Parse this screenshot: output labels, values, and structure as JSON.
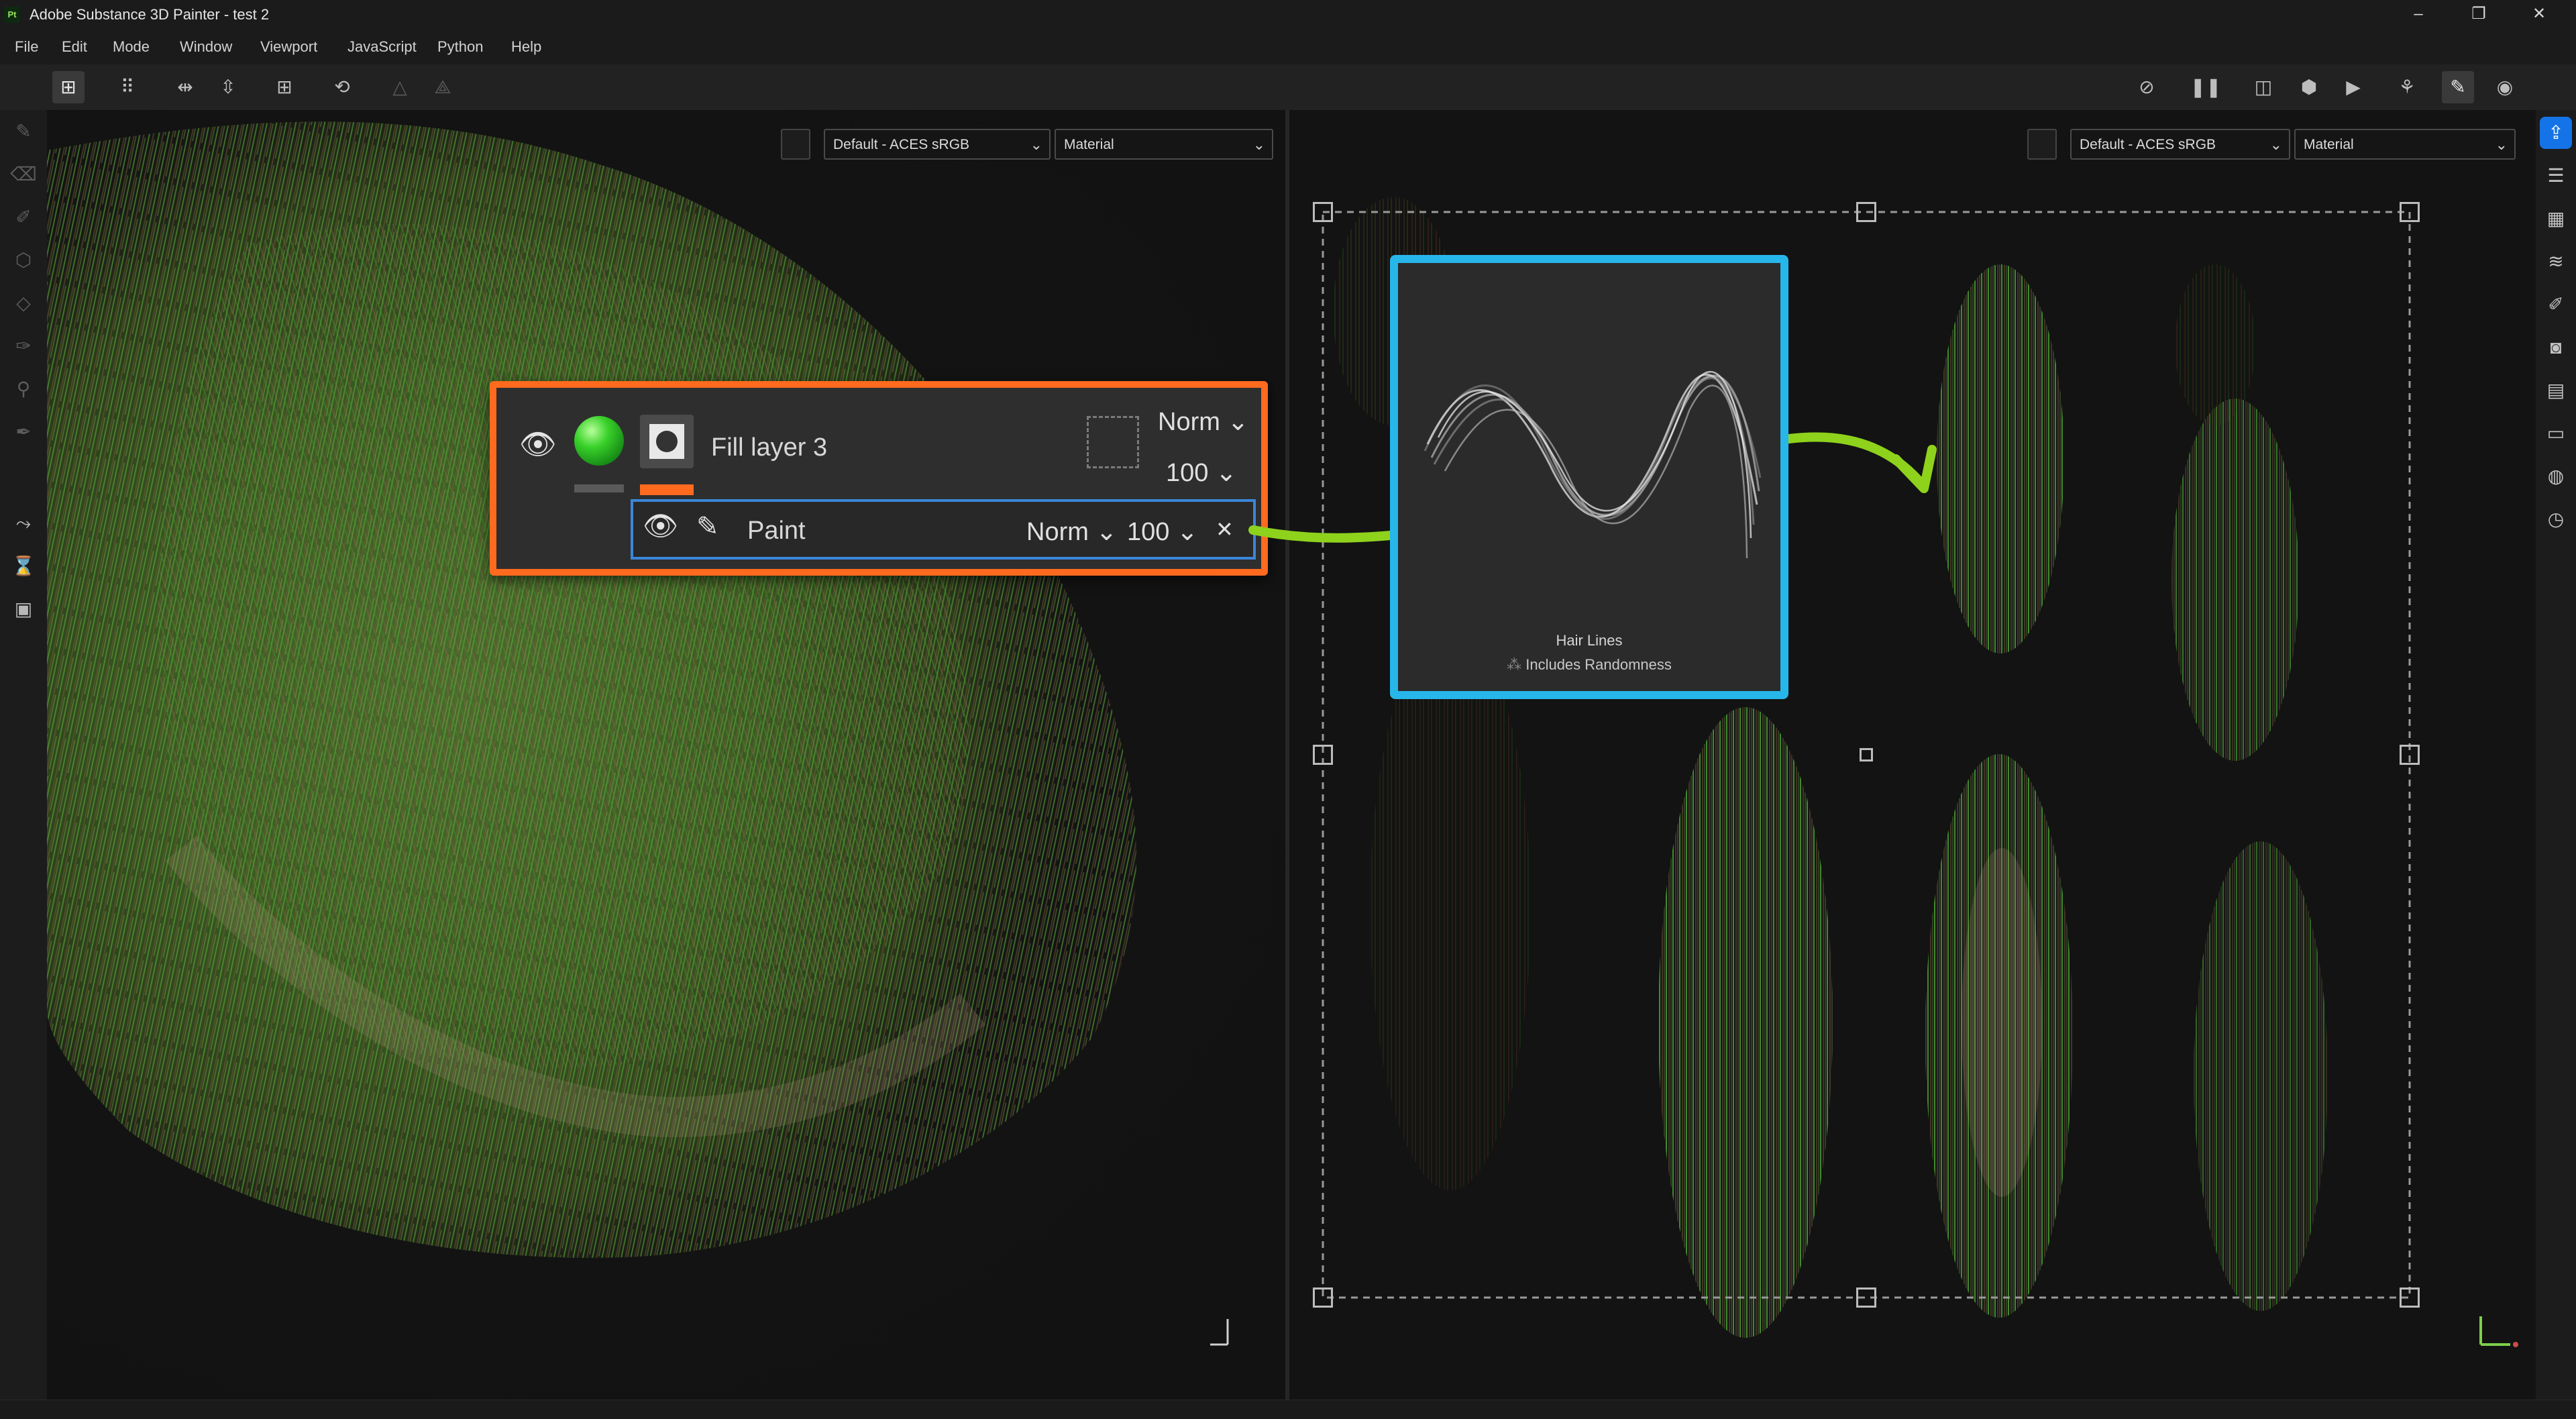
{
  "window": {
    "title": "Adobe Substance 3D Painter - test 2",
    "logo": "Pt",
    "controls": [
      "minimize-icon",
      "maximize-icon",
      "close-icon"
    ]
  },
  "menu": [
    "File",
    "Edit",
    "Mode",
    "Window",
    "Viewport",
    "JavaScript",
    "Python",
    "Help"
  ],
  "toolbar": {
    "left": [
      "grid-view-icon",
      "tiles-icon",
      "mirror-x-icon",
      "mirror-y-icon",
      "add-icon",
      "reset-icon",
      "symmetry-icon",
      "symmetry-alt-icon"
    ],
    "right": [
      "hide-icon",
      "pause-icon",
      "split-view-icon",
      "cube-icon",
      "camera-icon",
      "bake-icon",
      "brush-icon",
      "screenshot-icon"
    ]
  },
  "viewport3d": {
    "colorspace": "Default - ACES sRGB",
    "channel": "Material"
  },
  "viewport2d": {
    "colorspace": "Default - ACES sRGB",
    "channel": "Material"
  },
  "layer": {
    "name": "Fill layer 3",
    "blend": "Norm",
    "opacity": "100",
    "mask": {
      "name": "Paint",
      "blend": "Norm",
      "opacity": "100",
      "close": "✕"
    }
  },
  "brush_preset": {
    "name": "Hair Lines",
    "note": "Includes Randomness"
  },
  "colors": {
    "accent_orange": "#ff6a1f",
    "accent_blue": "#27b6ea",
    "arrow_green": "#8ed21c",
    "selection_blue": "#3c86d8"
  }
}
